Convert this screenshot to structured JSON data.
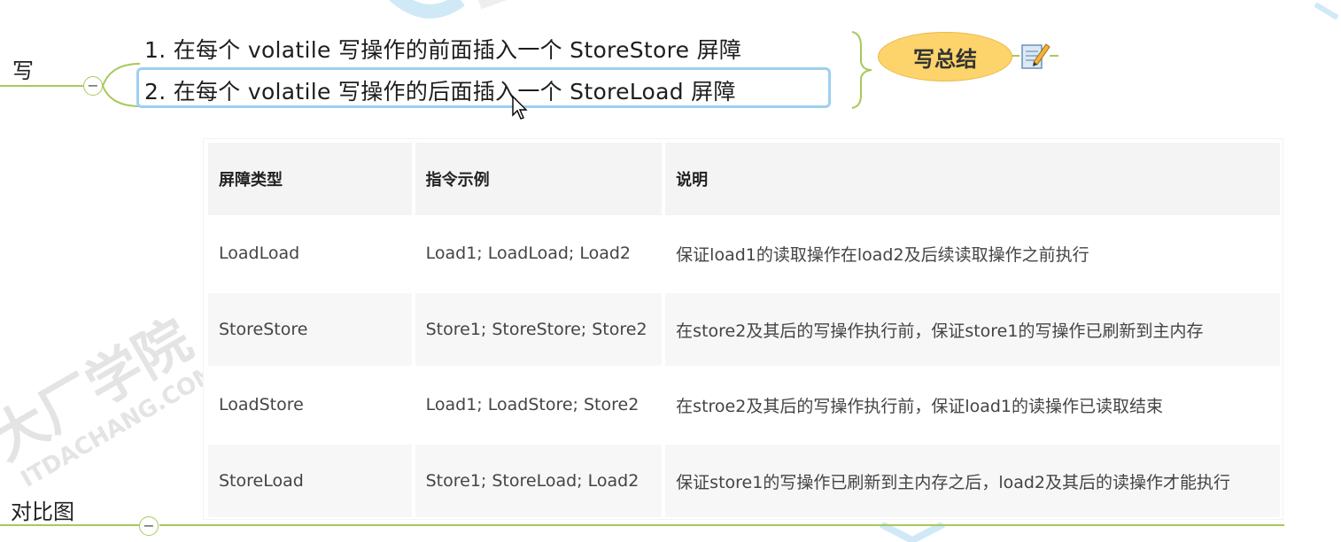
{
  "mindmap": {
    "node_write": "写",
    "node_compare": "对比图",
    "items": [
      {
        "label": "1.  在每个 volatile 写操作的前面插入一个 StoreStore 屏障"
      },
      {
        "label": "2.  在每个 volatile 写操作的后面插入一个 StoreLoad 屏障"
      }
    ],
    "summary_label": "写总结",
    "collapse_symbol": "−",
    "note_icon": "notepad-pencil-icon",
    "colors": {
      "branch": "#a7c95a",
      "summary_fill": "#fcd46b",
      "selection": "#9ed0f2"
    }
  },
  "table": {
    "headers": [
      "屏障类型",
      "指令示例",
      "说明"
    ],
    "rows": [
      [
        "LoadLoad",
        "Load1; LoadLoad; Load2",
        "保证load1的读取操作在load2及后续读取操作之前执行"
      ],
      [
        "StoreStore",
        "Store1; StoreStore; Store2",
        "在store2及其后的写操作执行前，保证store1的写操作已刷新到主内存"
      ],
      [
        "LoadStore",
        "Load1; LoadStore; Store2",
        "在stroe2及其后的写操作执行前，保证load1的读操作已读取结束"
      ],
      [
        "StoreLoad",
        "Store1; StoreLoad; Load2",
        "保证store1的写操作已刷新到主内存之后，load2及其后的读操作才能执行"
      ]
    ]
  },
  "watermark": {
    "line1": "大厂学院",
    "line2": "ITDACHANG.COM"
  }
}
